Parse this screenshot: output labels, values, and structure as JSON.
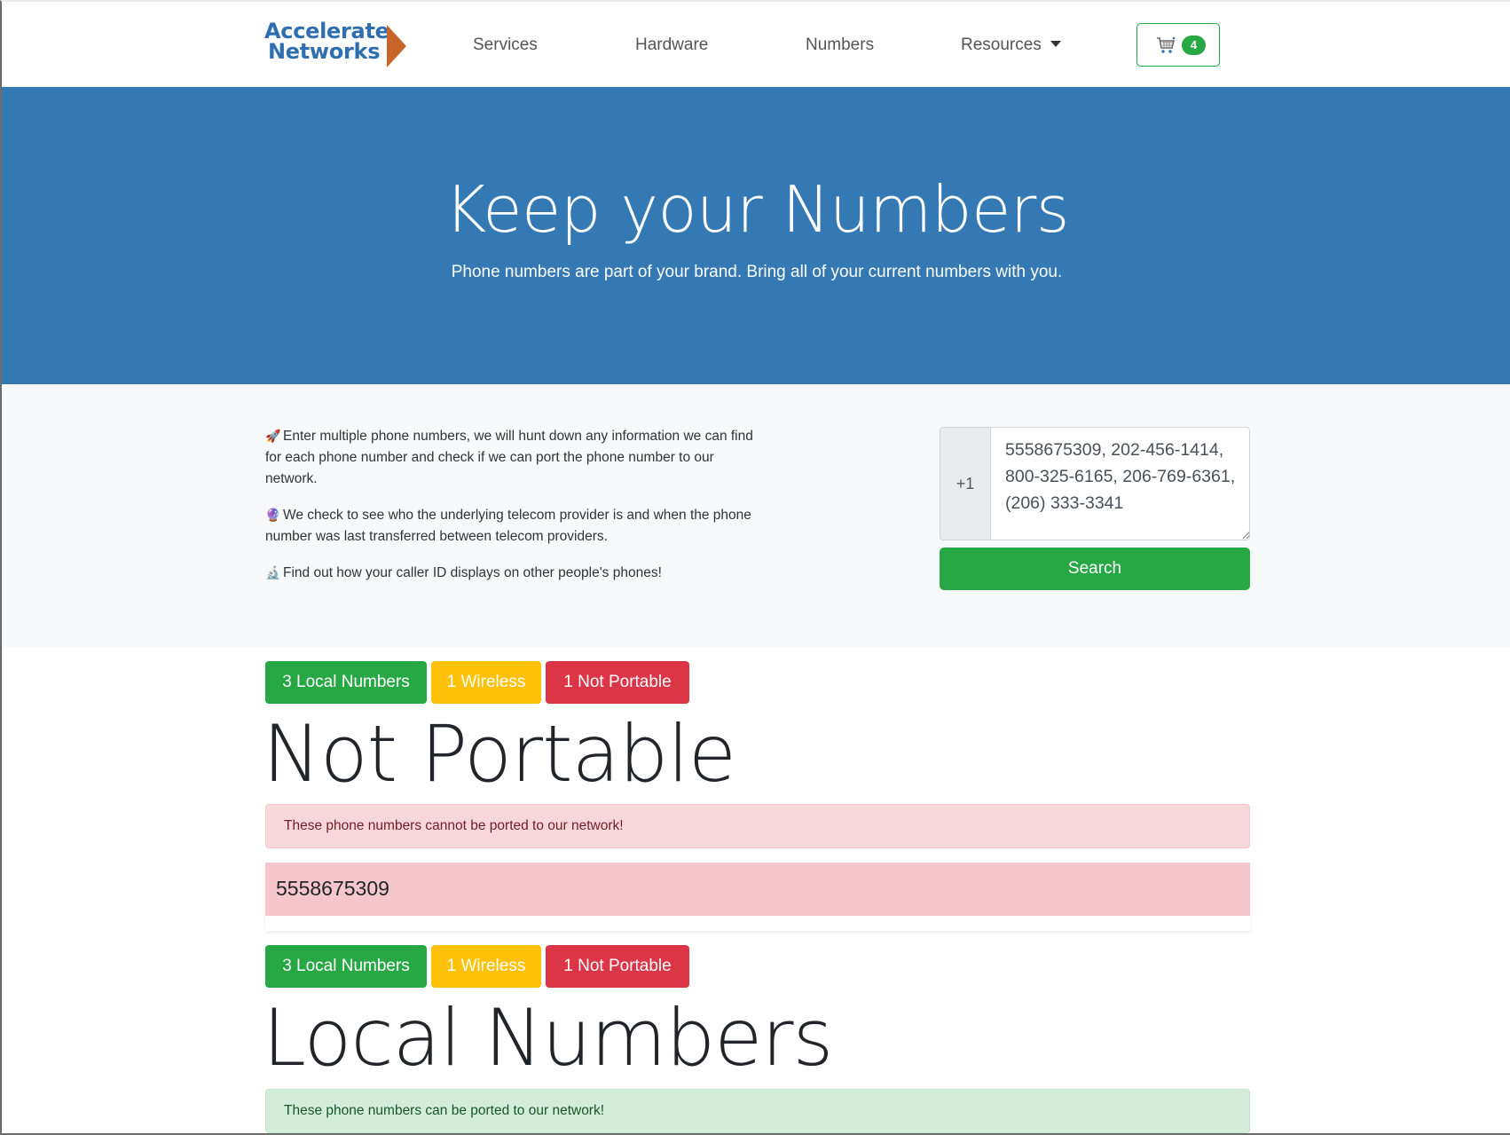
{
  "nav": {
    "logo_line1": "Accelerate",
    "logo_line2": "Networks",
    "links": [
      "Services",
      "Hardware",
      "Numbers",
      "Resources"
    ],
    "cart_count": "4",
    "colors": {
      "brand": "#2f6fb0",
      "logo_arrow": "#c9652a"
    }
  },
  "hero": {
    "title": "Keep your Numbers",
    "subtitle": "Phone numbers are part of your brand. Bring all of your current numbers with you.",
    "background": "#3478b4"
  },
  "search": {
    "info": [
      {
        "icon": "rocket-icon",
        "glyph": "🚀",
        "text": "Enter multiple phone numbers, we will hunt down any information we can find for each phone number and check if we can port the phone number to our network."
      },
      {
        "icon": "crystal-ball-icon",
        "glyph": "🔮",
        "text": "We check to see who the underlying telecom provider is and when the phone number was last transferred between telecom providers."
      },
      {
        "icon": "microscope-icon",
        "glyph": "🔬",
        "text": "Find out how your caller ID displays on other people's phones!"
      }
    ],
    "prefix": "+1",
    "numbers_value": "5558675309, 202-456-1414, 800-325-6165, 206-769-6361, (206) 333-3341",
    "button_label": "Search"
  },
  "summary": {
    "local": "3 Local Numbers",
    "wireless": "1 Wireless",
    "not_portable": "1 Not Portable",
    "colors": {
      "local": "#28a745",
      "wireless": "#ffc107",
      "not_portable": "#dc3545"
    }
  },
  "not_portable_section": {
    "heading": "Not Portable",
    "alert": "These phone numbers cannot be ported to our network!",
    "numbers": [
      "5558675309"
    ]
  },
  "local_section": {
    "heading": "Local Numbers",
    "alert": "These phone numbers can be ported to our network!"
  }
}
